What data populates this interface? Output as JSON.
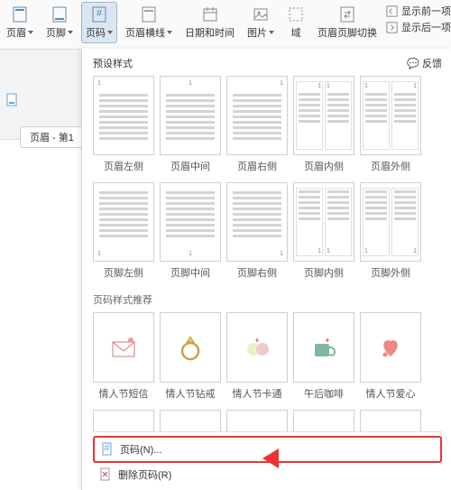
{
  "ribbon": {
    "header": "页眉",
    "footer": "页脚",
    "pageno": "页码",
    "hline": "页眉横线",
    "datetime": "日期和时间",
    "pic": "图片",
    "field": "域",
    "hf_switch": "页眉页脚切换",
    "show_prev": "显示前一项",
    "show_next": "显示后一项"
  },
  "doc": {
    "tab": "页眉 - 第1"
  },
  "popup": {
    "preset_title": "预设样式",
    "feedback": "反馈",
    "labels_hdr": [
      "页眉左侧",
      "页眉中间",
      "页眉右侧",
      "页眉内侧",
      "页眉外侧"
    ],
    "labels_ftr": [
      "页脚左侧",
      "页脚中间",
      "页脚右侧",
      "页脚内侧",
      "页脚外侧"
    ],
    "rec_title": "页码样式推荐",
    "rec_labels": [
      "情人节短信",
      "情人节钻戒",
      "情人节卡通",
      "午后咖啡",
      "情人节爱心"
    ],
    "menu_pageno": "页码(N)...",
    "menu_del": "删除页码(R)"
  }
}
